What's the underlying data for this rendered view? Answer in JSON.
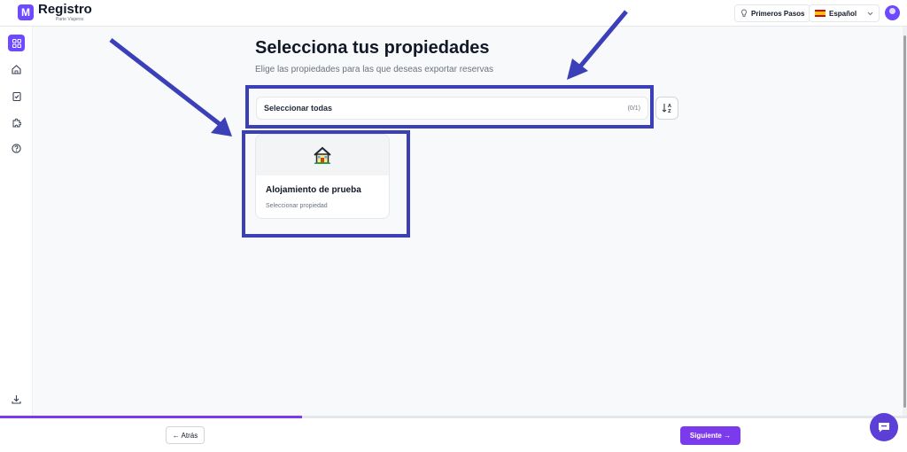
{
  "app": {
    "logo_icon": "registro-logo-icon",
    "brand_name": "Registro",
    "brand_subtitle": "Parte Viajeros"
  },
  "header": {
    "first_steps_label": "Primeros Pasos",
    "first_steps_icon": "lightbulb-icon",
    "language_label": "Español",
    "language_flag": "spain-flag-icon"
  },
  "sidebar": {
    "items": [
      {
        "name": "dashboard",
        "icon": "grid-icon",
        "active": true
      },
      {
        "name": "home",
        "icon": "home-icon",
        "active": false
      },
      {
        "name": "tasks",
        "icon": "clipboard-check-icon",
        "active": false
      },
      {
        "name": "integrations",
        "icon": "puzzle-icon",
        "active": false
      },
      {
        "name": "help",
        "icon": "help-circle-icon",
        "active": false
      },
      {
        "name": "download",
        "icon": "download-icon",
        "active": false
      }
    ]
  },
  "main": {
    "title": "Selecciona tus propiedades",
    "subtitle": "Elige las propiedades para las que deseas exportar reservas",
    "select_all_label": "Seleccionar todas",
    "selected_count": "(0/1)",
    "sort_icon": "sort-az-icon",
    "properties": [
      {
        "name": "Alojamiento de prueba",
        "action": "Seleccionar propiedad",
        "icon": "house-icon"
      }
    ]
  },
  "footer": {
    "back_label": "← Atrás",
    "next_label": "Siguiente →",
    "progress": 0.333
  },
  "colors": {
    "accent": "#7c3aed",
    "highlight": "#3b3fb8"
  }
}
